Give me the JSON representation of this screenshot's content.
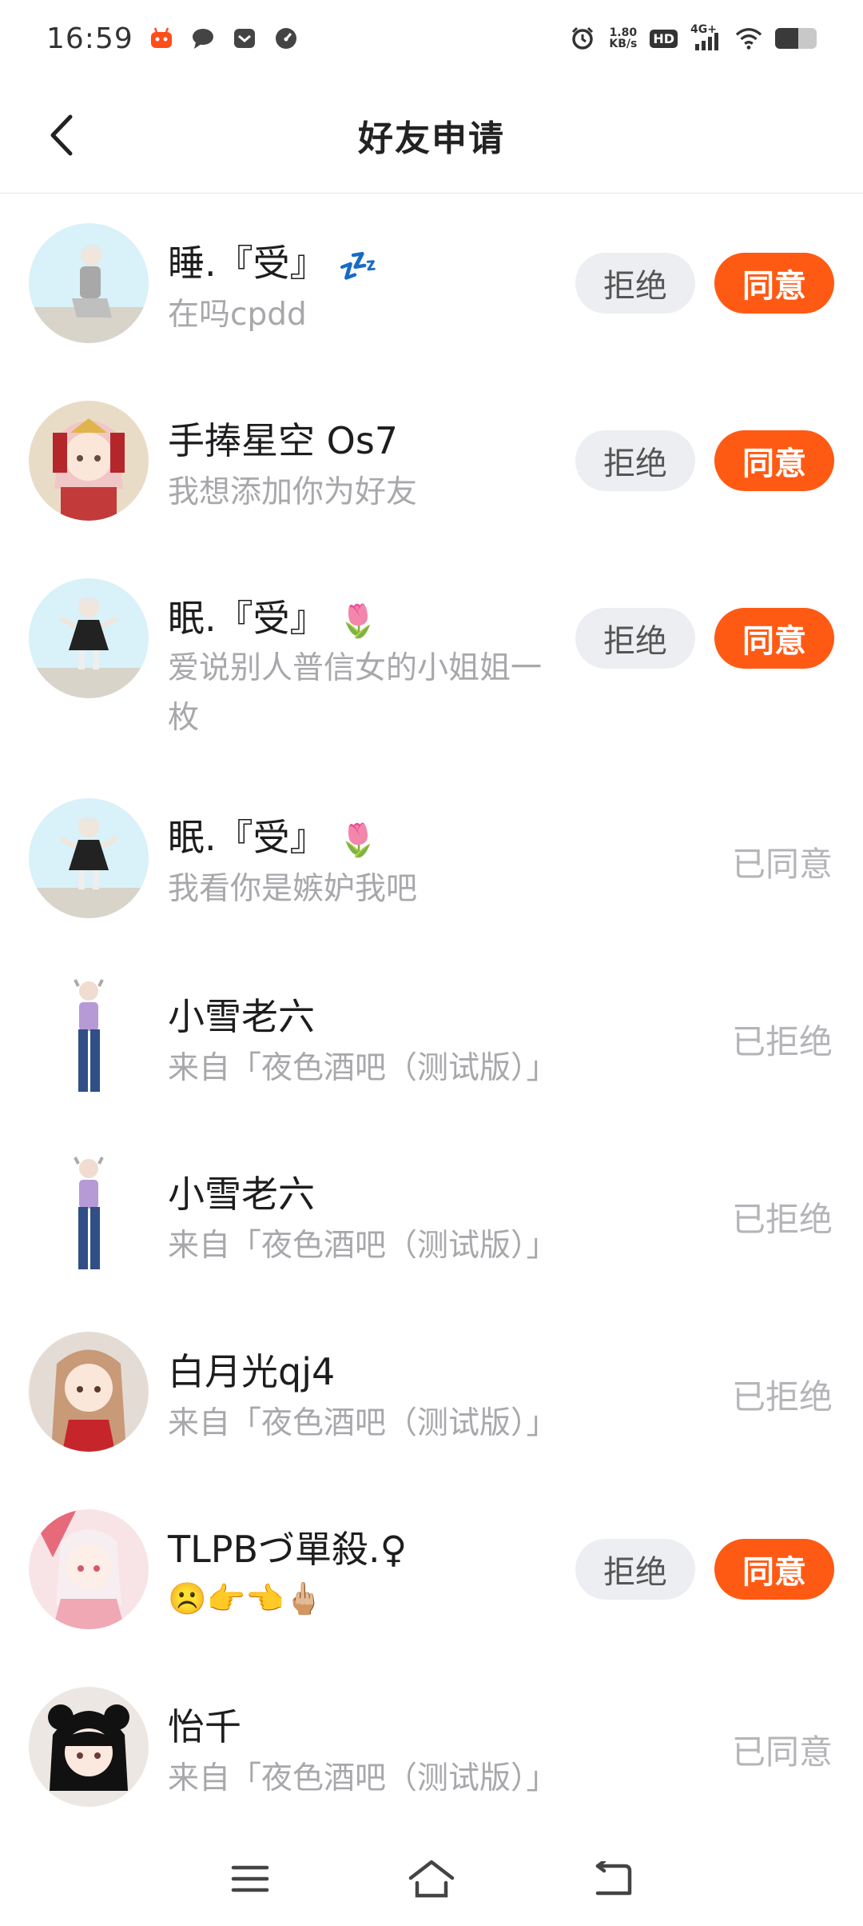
{
  "status_bar": {
    "time": "16:59",
    "net_speed_value": "1.80",
    "net_speed_unit": "KB/s",
    "hd_label": "HD",
    "signal_label": "4G+",
    "battery_level": 0.55,
    "icons": [
      "app-notification-icon",
      "message-icon",
      "mail-icon",
      "gauge-icon",
      "alarm-icon",
      "signal-icon",
      "wifi-icon",
      "battery-icon"
    ]
  },
  "header": {
    "title": "好友申请",
    "back_icon": "chevron-left-icon"
  },
  "requests": [
    {
      "name": "睡.『受』",
      "emoji": "💤",
      "message": "在吗cpdd",
      "state": "pending",
      "reject_label": "拒绝",
      "accept_label": "同意"
    },
    {
      "name": "手捧星空 Os7",
      "emoji": "",
      "message": "我想添加你为好友",
      "state": "pending",
      "reject_label": "拒绝",
      "accept_label": "同意"
    },
    {
      "name": "眠.『受』",
      "emoji": "🌷",
      "message": "爱说别人普信女的小姐姐一枚",
      "state": "pending",
      "reject_label": "拒绝",
      "accept_label": "同意"
    },
    {
      "name": "眠.『受』",
      "emoji": "🌷",
      "message": "我看你是嫉妒我吧",
      "state": "done",
      "status_text": "已同意"
    },
    {
      "name": "小雪老六",
      "emoji": "",
      "message": "来自「夜色酒吧（测试版）」",
      "state": "done",
      "status_text": "已拒绝"
    },
    {
      "name": "小雪老六",
      "emoji": "",
      "message": "来自「夜色酒吧（测试版）」",
      "state": "done",
      "status_text": "已拒绝"
    },
    {
      "name": "白月光qj4",
      "emoji": "",
      "message": "来自「夜色酒吧（测试版）」",
      "state": "done",
      "status_text": "已拒绝"
    },
    {
      "name": "TLPBづ單殺.♀",
      "emoji": "",
      "message": "☹️👉👈🖕🏼",
      "state": "pending",
      "reject_label": "拒绝",
      "accept_label": "同意"
    },
    {
      "name": "怡千",
      "emoji": "",
      "message": "来自「夜色酒吧（测试版）」",
      "state": "done",
      "status_text": "已同意"
    }
  ],
  "bottom_nav": {
    "icons": [
      "menu-icon",
      "home-icon",
      "back-icon"
    ]
  }
}
